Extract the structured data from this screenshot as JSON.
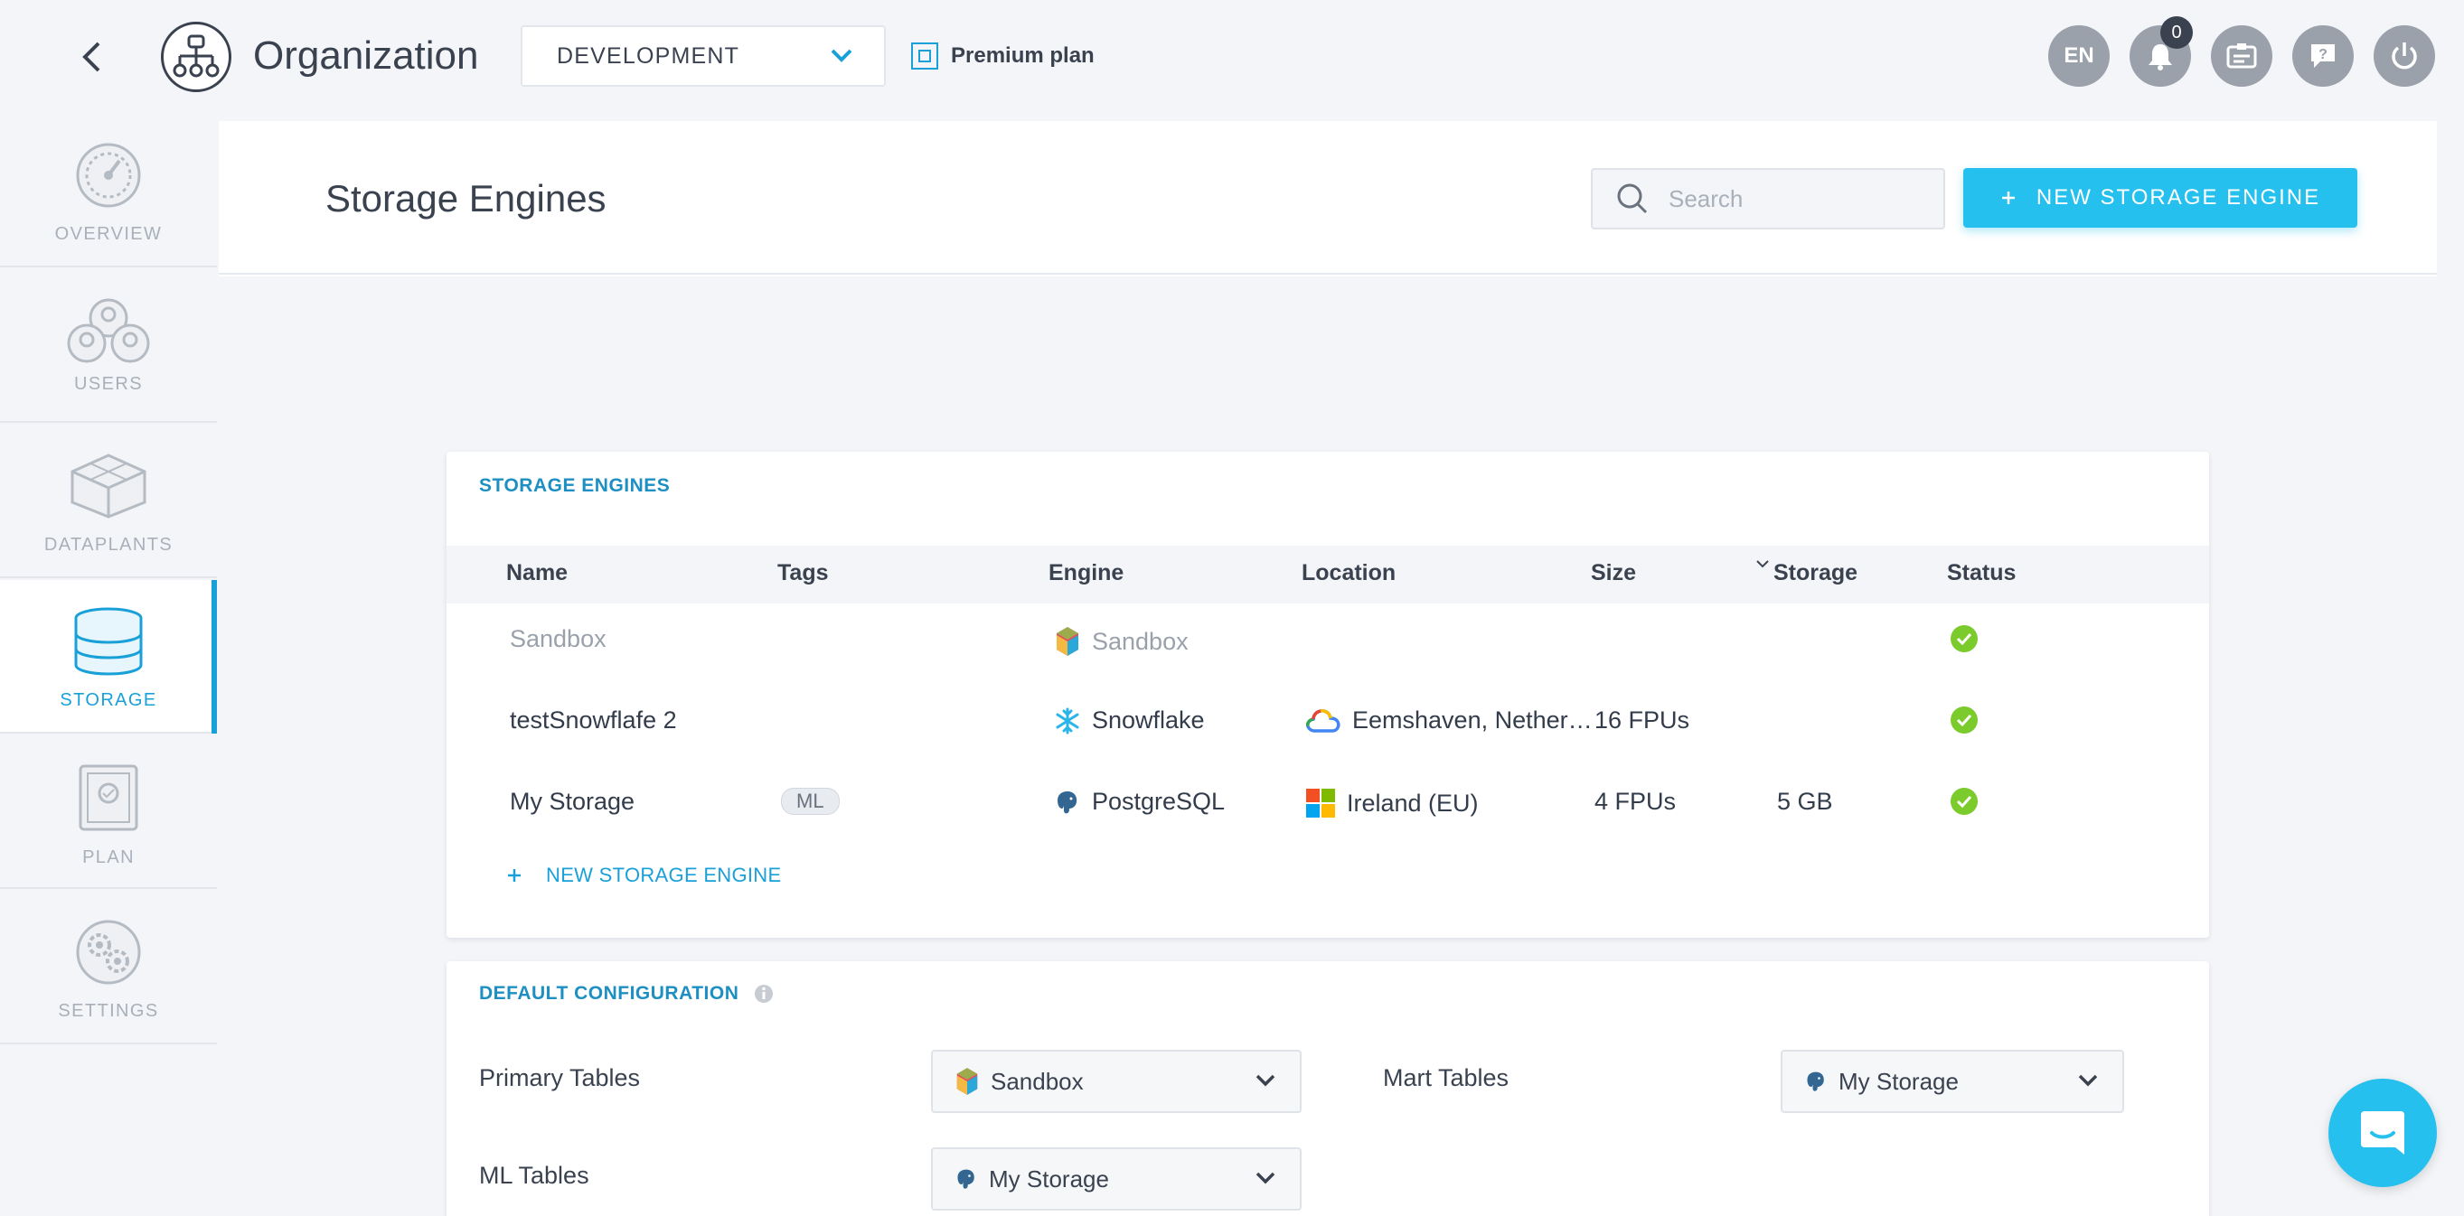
{
  "header": {
    "title": "Organization",
    "environment": "DEVELOPMENT",
    "plan": "Premium plan",
    "language": "EN",
    "notification_count": "0"
  },
  "sidebar": {
    "items": [
      {
        "label": "OVERVIEW",
        "icon": "gauge-icon"
      },
      {
        "label": "USERS",
        "icon": "users-icon"
      },
      {
        "label": "DATAPLANTS",
        "icon": "cubes-icon"
      },
      {
        "label": "STORAGE",
        "icon": "database-icon",
        "active": true
      },
      {
        "label": "PLAN",
        "icon": "plan-icon"
      },
      {
        "label": "SETTINGS",
        "icon": "gears-icon"
      }
    ]
  },
  "main": {
    "title": "Storage Engines",
    "search_placeholder": "Search",
    "new_button": "NEW STORAGE ENGINE"
  },
  "engines_card": {
    "title": "STORAGE ENGINES",
    "columns": [
      "Name",
      "Tags",
      "Engine",
      "Location",
      "Size",
      "Storage",
      "Status"
    ],
    "rows": [
      {
        "name": "Sandbox",
        "tag": "",
        "engine": "Sandbox",
        "location": "",
        "size": "",
        "storage": "",
        "status": "ok"
      },
      {
        "name": "testSnowflafe 2",
        "tag": "",
        "engine": "Snowflake",
        "location": "Eemshaven, Nether…",
        "size": "16 FPUs",
        "storage": "",
        "status": "ok"
      },
      {
        "name": "My Storage",
        "tag": "ML",
        "engine": "PostgreSQL",
        "location": "Ireland (EU)",
        "size": "4 FPUs",
        "storage": "5 GB",
        "status": "ok"
      }
    ],
    "add_link": "NEW STORAGE ENGINE"
  },
  "config_card": {
    "title": "DEFAULT CONFIGURATION",
    "primary_label": "Primary Tables",
    "primary_value": "Sandbox",
    "mart_label": "Mart Tables",
    "mart_value": "My Storage",
    "ml_label": "ML Tables",
    "ml_value": "My Storage"
  },
  "colors": {
    "accent": "#1aa0d8",
    "button": "#25c0ee",
    "success": "#7bcb2c",
    "text": "#3a4250"
  }
}
